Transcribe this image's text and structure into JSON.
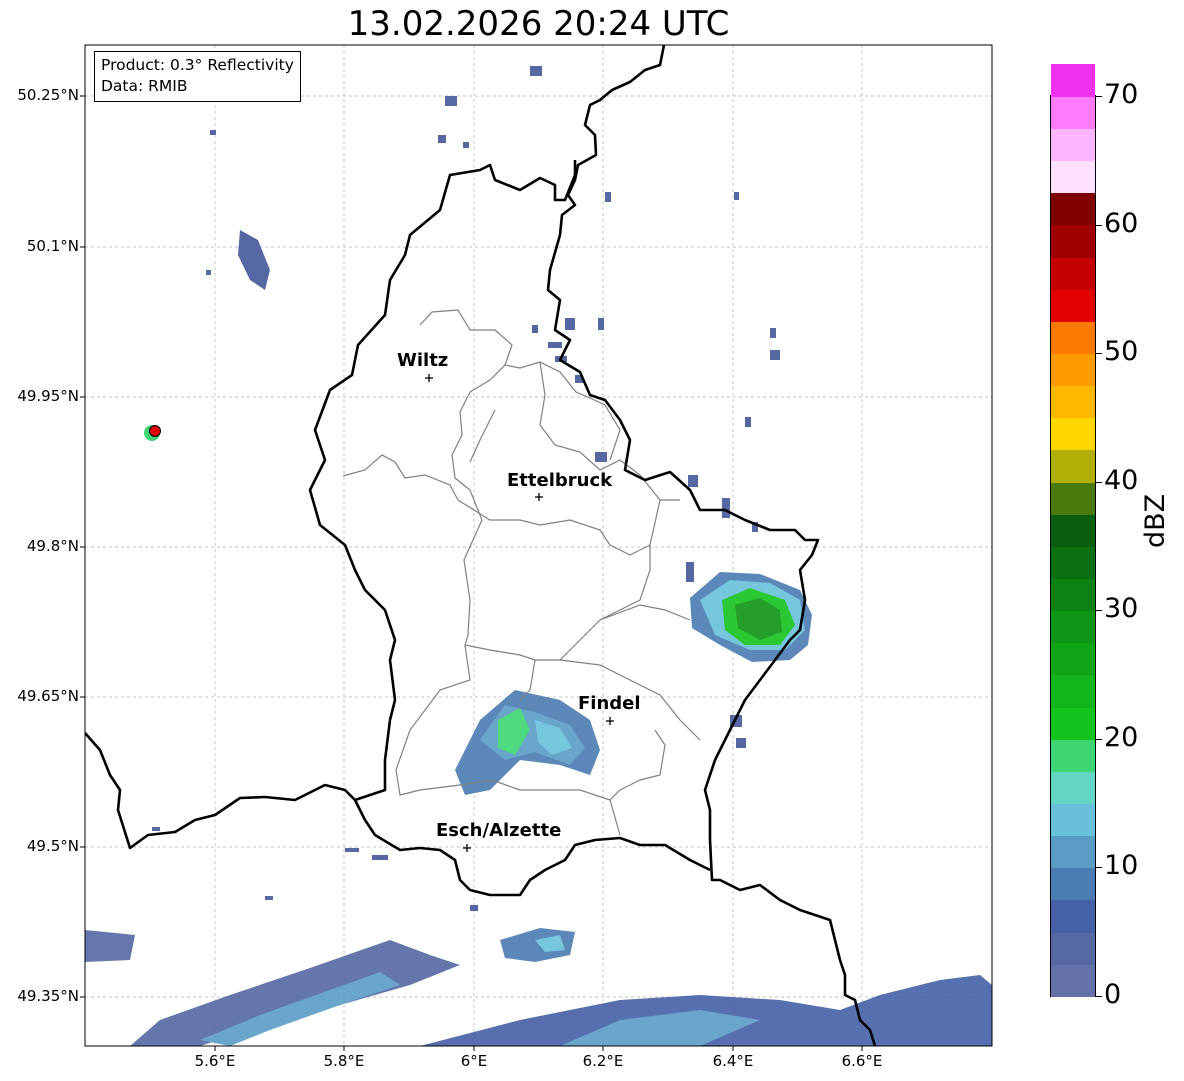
{
  "title": "13.02.2026 20:24 UTC",
  "info": {
    "product": "Product: 0.3° Reflectivity",
    "data": "Data: RMIB"
  },
  "lat_labels": [
    "50.25°N",
    "50.1°N",
    "49.95°N",
    "49.8°N",
    "49.65°N",
    "49.5°N",
    "49.35°N"
  ],
  "lon_labels": [
    "5.6°E",
    "5.8°E",
    "6°E",
    "6.2°E",
    "6.4°E",
    "6.6°E"
  ],
  "cities": {
    "wiltz": "Wiltz",
    "ettelbruck": "Ettelbruck",
    "findel": "Findel",
    "esch": "Esch/Alzette"
  },
  "colorbar": {
    "label": "dBZ",
    "ticks": [
      "0",
      "10",
      "20",
      "30",
      "40",
      "50",
      "60",
      "70"
    ],
    "colors": [
      "#6470a8",
      "#5568a4",
      "#4560a6",
      "#4a7cb2",
      "#5a9cc6",
      "#68c0da",
      "#62d6c2",
      "#3ed672",
      "#14c41e",
      "#12b41c",
      "#10a418",
      "#0e9416",
      "#0c8214",
      "#0a7012",
      "#0a5c0e",
      "#487a0c",
      "#b0b008",
      "#ffd800",
      "#ffb800",
      "#ff9a00",
      "#ff7a00",
      "#e20000",
      "#c40000",
      "#a00000",
      "#800000",
      "#ffe0ff",
      "#ffb4ff",
      "#ff7cff",
      "#f032f0"
    ]
  },
  "colors": {
    "border_country": "#000000",
    "border_canton": "#808080",
    "radar_site": "#e00000"
  }
}
